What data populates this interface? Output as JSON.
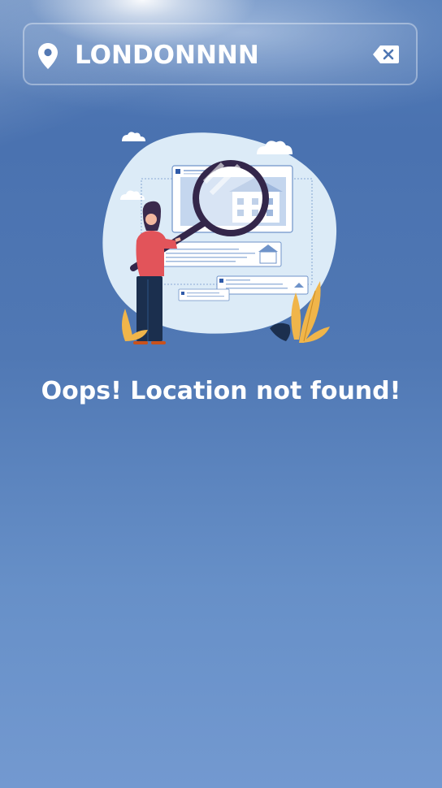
{
  "search": {
    "value": "LONDONNNN",
    "location_icon": "location-pin-icon",
    "clear_icon": "backspace-clear-icon"
  },
  "illustration": {
    "name": "search-not-found-illustration"
  },
  "status": {
    "message": "Oops! Location not found!"
  },
  "colors": {
    "sky_top": "#4f79b6",
    "sky_bottom": "#7399d0",
    "text": "#ffffff",
    "accent_yellow": "#f0b54a",
    "accent_red": "#e2545a",
    "dark_navy": "#1b2f4e"
  }
}
